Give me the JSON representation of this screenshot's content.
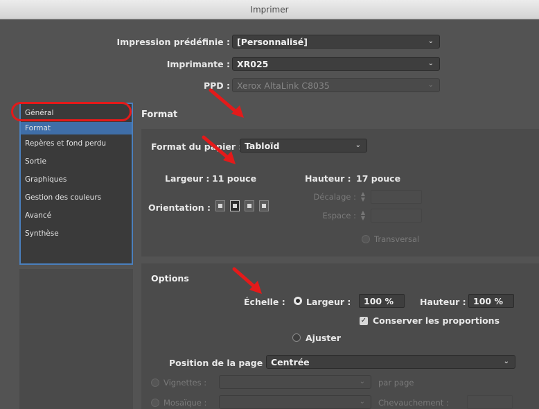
{
  "window": {
    "title": "Imprimer"
  },
  "top": {
    "preset_label": "Impression prédéfinie :",
    "preset_value": "[Personnalisé]",
    "printer_label": "Imprimante :",
    "printer_value": "XR025",
    "ppd_label": "PPD :",
    "ppd_value": "Xerox AltaLink C8035"
  },
  "sidebar": {
    "items": [
      {
        "label": "Général"
      },
      {
        "label": "Format"
      },
      {
        "label": "Repères et fond perdu"
      },
      {
        "label": "Sortie"
      },
      {
        "label": "Graphiques"
      },
      {
        "label": "Gestion des couleurs"
      },
      {
        "label": "Avancé"
      },
      {
        "label": "Synthèse"
      }
    ],
    "selected_index": 1
  },
  "format": {
    "header": "Format",
    "paper_label": "Format du papier :",
    "paper_value": "Tabloïd",
    "width_label": "Largeur :",
    "width_value": "11 pouce",
    "height_label": "Hauteur :",
    "height_value": "17 pouce",
    "orientation_label": "Orientation :",
    "offset_label": "Décalage :",
    "spacing_label": "Espace :",
    "transverse_label": "Transversal"
  },
  "options": {
    "header": "Options",
    "scale_label": "Échelle :",
    "scale_width_label": "Largeur :",
    "scale_width_value": "100 %",
    "scale_height_label": "Hauteur :",
    "scale_height_value": "100 %",
    "keep_proportions_label": "Conserver les proportions",
    "keep_proportions_checked": true,
    "fit_label": "Ajuster",
    "page_position_label": "Position de la page :",
    "page_position_value": "Centrée",
    "thumbnails_label": "Vignettes :",
    "per_page_label": "par page",
    "tiling_label": "Mosaïque :",
    "overlap_label": "Chevauchement :"
  },
  "colors": {
    "annotation": "#e41a1a",
    "selection": "#3f6ea8",
    "sidebar_border": "#4a7fbd"
  }
}
